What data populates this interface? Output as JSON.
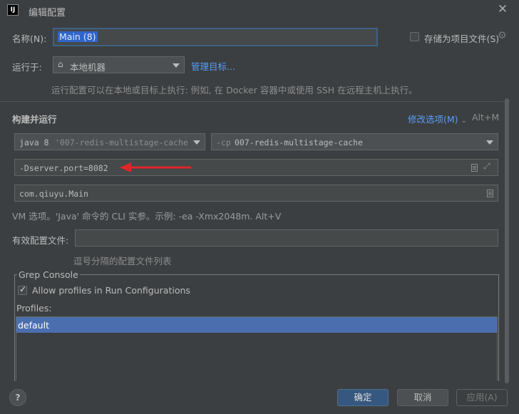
{
  "window": {
    "title": "编辑配置",
    "app_icon_text": "IJ",
    "close_icon": "close-icon"
  },
  "name_row": {
    "label": "名称(N):",
    "value": "Main (8)",
    "store_label": "存储为项目文件(S)",
    "store_checked": false
  },
  "run_on": {
    "label": "运行于:",
    "selected": "本地机器",
    "manage_link": "管理目标...",
    "hint": "运行配置可以在本地或目标上执行: 例如, 在 Docker 容器中或使用 SSH 在远程主机上执行。"
  },
  "build_run": {
    "heading": "构建并运行",
    "modify_link": "修改选项(M)",
    "modify_shortcut": "Alt+M",
    "jre_prefix": "java 8",
    "jre_module": "'007-redis-multistage-cache",
    "cp_prefix": "-cp",
    "cp_value": "007-redis-multistage-cache",
    "vm_options": "-Dserver.port=8082",
    "main_class": "com.qiuyu.Main",
    "vm_hint": "VM 选项。'Java' 命令的 CLI 实参。示例: -ea -Xmx2048m. Alt+V"
  },
  "active_profiles": {
    "label": "有效配置文件:",
    "value": "",
    "hint": "逗号分隔的配置文件列表"
  },
  "grep_console": {
    "title": "Grep Console",
    "allow_label": "Allow profiles in Run Configurations",
    "allow_checked": true,
    "profiles_label": "Profiles:",
    "profiles": [
      "default"
    ]
  },
  "footer": {
    "help": "?",
    "ok": "确定",
    "cancel": "取消",
    "apply": "应用(A)"
  },
  "colors": {
    "background": "#3c3f41",
    "accent": "#365880",
    "selection": "#4b6eaf",
    "arrow": "#e0252a",
    "link": "#589df6"
  }
}
